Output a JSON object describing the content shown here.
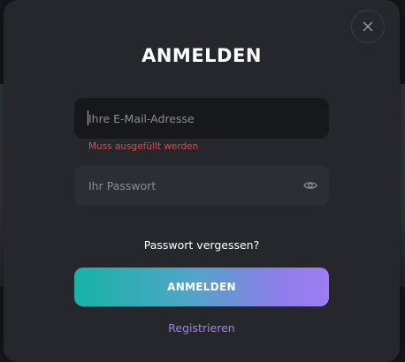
{
  "modal": {
    "title": "ANMELDEN",
    "close_icon": "close-icon"
  },
  "email": {
    "value": "",
    "placeholder": "Ihre E-Mail-Adresse",
    "error": "Muss ausgefüllt werden"
  },
  "password": {
    "value": "",
    "placeholder": "Ihr Passwort",
    "toggle_icon": "eye-icon"
  },
  "links": {
    "forgot": "Passwort vergessen?",
    "register": "Registrieren"
  },
  "submit": {
    "label": "ANMELDEN"
  },
  "colors": {
    "background": "#26272c",
    "error": "#e0494a",
    "accent_start": "#16b3a6",
    "accent_end": "#a07cf4",
    "register_link": "#a77ff0"
  }
}
